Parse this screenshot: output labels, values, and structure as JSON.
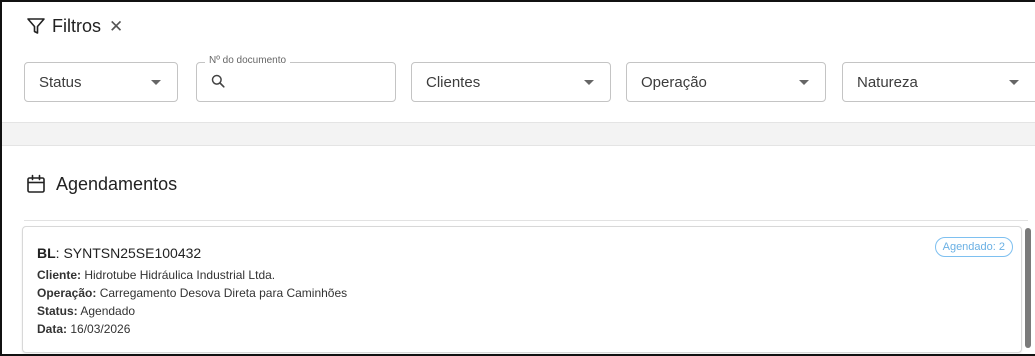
{
  "filters": {
    "title": "Filtros",
    "close_symbol": "✕",
    "status_label": "Status",
    "doc_legend": "Nº do documento",
    "doc_value": "",
    "clientes_label": "Clientes",
    "operacao_label": "Operação",
    "natureza_label": "Natureza"
  },
  "agendamentos": {
    "title": "Agendamentos",
    "card": {
      "bl_key": "BL",
      "bl_value": ": SYNTSN25SE100432",
      "badge": "Agendado: 2",
      "cliente_key": "Cliente:",
      "cliente_value": " Hidrotube Hidráulica Industrial Ltda.",
      "operacao_key": "Operação:",
      "operacao_value": " Carregamento Desova Direta para Caminhões",
      "status_key": "Status:",
      "status_value": " Agendado",
      "data_key": "Data:",
      "data_value": " 16/03/2026"
    }
  },
  "icons": {
    "filter": "filter-icon",
    "search": "search-icon",
    "calendar": "calendar-icon"
  },
  "colors": {
    "badge": "#6ab0e4",
    "border": "#c4c4c4"
  }
}
